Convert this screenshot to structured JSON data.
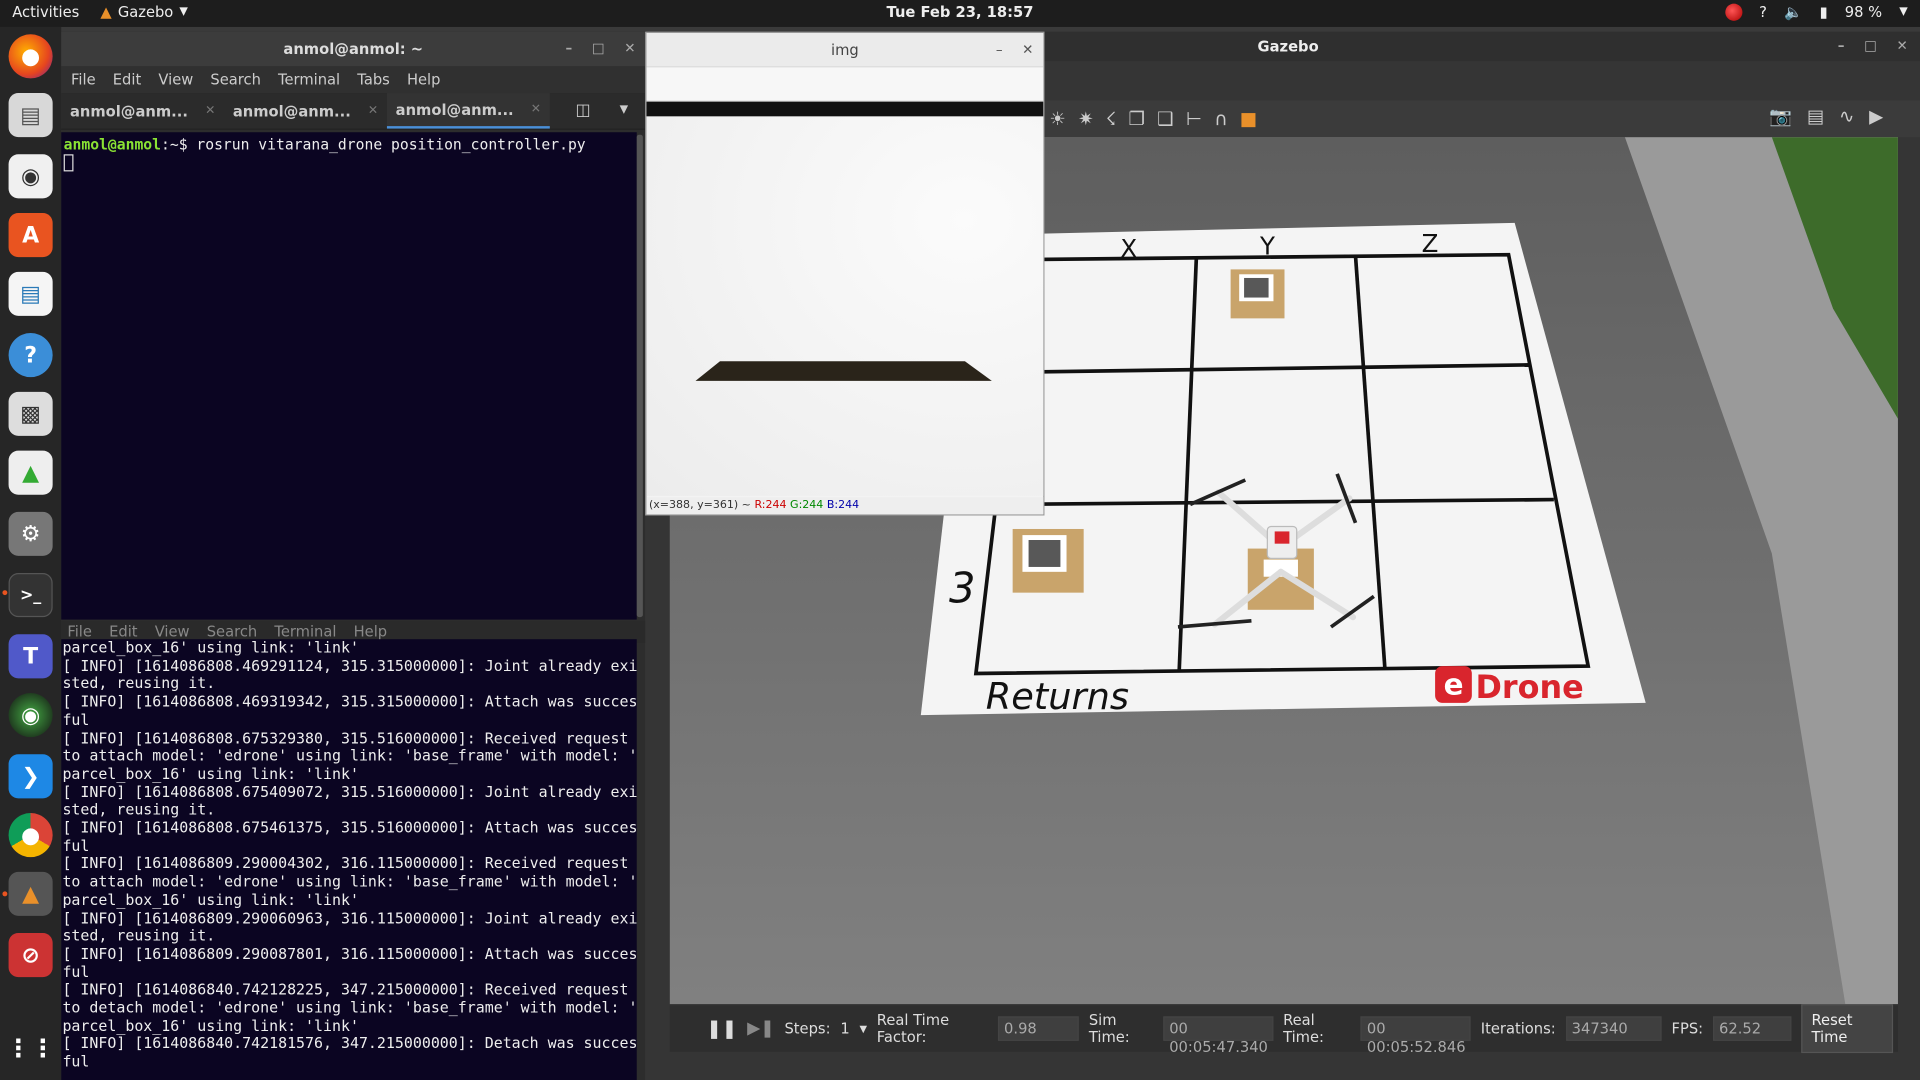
{
  "topbar": {
    "activities": "Activities",
    "app_name": "Gazebo",
    "clock": "Tue Feb 23, 18:57",
    "battery": "98 %"
  },
  "dock": {
    "items": [
      "firefox",
      "files",
      "rhythmbox",
      "software",
      "writer",
      "help",
      "settings-board",
      "photos",
      "gear-settings",
      "terminal",
      "teams",
      "camera",
      "vscode",
      "chrome",
      "gazebo",
      "system-monitor"
    ]
  },
  "terminal": {
    "title": "anmol@anmol: ~",
    "menu": [
      "File",
      "Edit",
      "View",
      "Search",
      "Terminal",
      "Tabs",
      "Help"
    ],
    "tabs": [
      "anmol@anm...",
      "anmol@anm...",
      "anmol@anm..."
    ],
    "prompt_user": "anmol@anmol",
    "prompt_rest": ":~$ rosrun vitarana_drone position_controller.py",
    "bottom_menu": [
      "File",
      "Edit",
      "View",
      "Search",
      "Terminal",
      "Help"
    ],
    "log": "parcel_box_16' using link: 'link'\n[ INFO] [1614086808.469291124, 315.315000000]: Joint already exi\nsted, reusing it.\n[ INFO] [1614086808.469319342, 315.315000000]: Attach was succes\nful\n[ INFO] [1614086808.675329380, 315.516000000]: Received request\nto attach model: 'edrone' using link: 'base_frame' with model: '\nparcel_box_16' using link: 'link'\n[ INFO] [1614086808.675409072, 315.516000000]: Joint already exi\nsted, reusing it.\n[ INFO] [1614086808.675461375, 315.516000000]: Attach was succes\nful\n[ INFO] [1614086809.290004302, 316.115000000]: Received request\nto attach model: 'edrone' using link: 'base_frame' with model: '\nparcel_box_16' using link: 'link'\n[ INFO] [1614086809.290060963, 316.115000000]: Joint already exi\nsted, reusing it.\n[ INFO] [1614086809.290087801, 316.115000000]: Attach was succes\nful\n[ INFO] [1614086840.742128225, 347.215000000]: Received request\nto detach model: 'edrone' using link: 'base_frame' with model: '\nparcel_box_16' using link: 'link'\n[ INFO] [1614086840.742181576, 347.215000000]: Detach was succes\nful"
  },
  "img_window": {
    "title": "img",
    "status_pos": "(x=388, y=361) ~",
    "status_r": "R:244",
    "status_g": "G:244",
    "status_b": "B:244"
  },
  "gazebo": {
    "title": "Gazebo",
    "grid_labels": [
      "X",
      "Y",
      "Z"
    ],
    "row_label": "3",
    "returns_label": "Returns",
    "brand": "Drone",
    "brand_e": "e",
    "status": {
      "steps_label": "Steps:",
      "steps_value": "1",
      "rtf_label": "Real Time Factor:",
      "rtf_value": "0.98",
      "sim_time_label": "Sim Time:",
      "sim_time_value": "00 00:05:47.340",
      "real_time_label": "Real Time:",
      "real_time_value": "00 00:05:52.846",
      "iterations_label": "Iterations:",
      "iterations_value": "347340",
      "fps_label": "FPS:",
      "fps_value": "62.52",
      "reset_label": "Reset Time"
    }
  },
  "colors": {
    "terminal_bg": "#0b0522",
    "prompt_green": "#8ae234",
    "brand_red": "#d9252d",
    "ubuntu_orange": "#e95420"
  }
}
